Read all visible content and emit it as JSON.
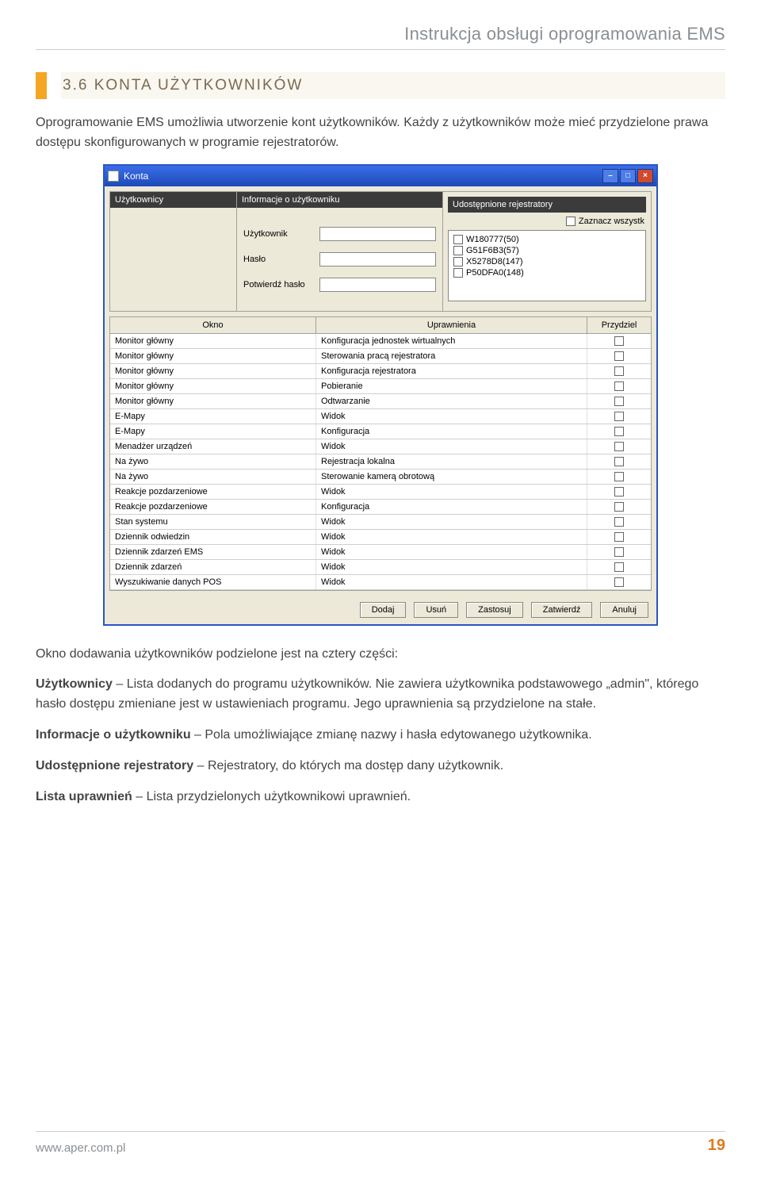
{
  "header": {
    "title": "Instrukcja obsługi oprogramowania EMS"
  },
  "section": {
    "number_title": "3.6   KONTA UŻYTKOWNIKÓW"
  },
  "intro_para": "Oprogramowanie EMS umożliwia utworzenie kont użytkowników. Każdy z użytkowników może mieć przydzielone prawa dostępu skonfigurowanych w programie rejestratorów.",
  "window": {
    "title": "Konta",
    "col_users_header": "Użytkownicy",
    "col_info_header": "Informacje o użytkowniku",
    "fields": {
      "user": "Użytkownik",
      "pass": "Hasło",
      "confirm": "Potwierdź hasło"
    },
    "col_regs_header": "Udostępnione rejestratory",
    "select_all": "Zaznacz wszystk",
    "regs": [
      "W180777(50)",
      "G51F6B3(57)",
      "X5278D8(147)",
      "P50DFA0(148)"
    ],
    "grid_headers": {
      "okno": "Okno",
      "upr": "Uprawnienia",
      "prz": "Przydziel"
    },
    "rows": [
      {
        "okno": "Monitor główny",
        "upr": "Konfiguracja jednostek wirtualnych"
      },
      {
        "okno": "Monitor główny",
        "upr": "Sterowania pracą rejestratora"
      },
      {
        "okno": "Monitor główny",
        "upr": "Konfiguracja rejestratora"
      },
      {
        "okno": "Monitor główny",
        "upr": "Pobieranie"
      },
      {
        "okno": "Monitor główny",
        "upr": "Odtwarzanie"
      },
      {
        "okno": "E-Mapy",
        "upr": "Widok"
      },
      {
        "okno": "E-Mapy",
        "upr": "Konfiguracja"
      },
      {
        "okno": "Menadżer urządzeń",
        "upr": "Widok"
      },
      {
        "okno": "Na żywo",
        "upr": "Rejestracja lokalna"
      },
      {
        "okno": "Na żywo",
        "upr": "Sterowanie kamerą obrotową"
      },
      {
        "okno": "Reakcje pozdarzeniowe",
        "upr": "Widok"
      },
      {
        "okno": "Reakcje pozdarzeniowe",
        "upr": "Konfiguracja"
      },
      {
        "okno": "Stan systemu",
        "upr": "Widok"
      },
      {
        "okno": "Dziennik odwiedzin",
        "upr": "Widok"
      },
      {
        "okno": "Dziennik zdarzeń EMS",
        "upr": "Widok"
      },
      {
        "okno": "Dziennik zdarzeń",
        "upr": "Widok"
      },
      {
        "okno": "Wyszukiwanie danych POS",
        "upr": "Widok"
      }
    ],
    "buttons": {
      "add": "Dodaj",
      "del": "Usuń",
      "apply": "Zastosuj",
      "confirm": "Zatwierdź",
      "cancel": "Anuluj"
    }
  },
  "below": {
    "p1": "Okno dodawania użytkowników podzielone jest na cztery części:",
    "p2a": "Użytkownicy",
    "p2b": " – Lista dodanych do programu użytkowników. Nie zawiera użytkownika podstawowego „admin\", którego hasło dostępu zmieniane jest w ustawieniach programu. Jego uprawnienia są przydzielone na stałe.",
    "p3a": "Informacje o użytkowniku",
    "p3b": " – Pola umożliwiające zmianę nazwy i hasła edytowanego użytkownika.",
    "p4a": "Udostępnione rejestratory",
    "p4b": " – Rejestratory, do których ma dostęp dany użytkownik.",
    "p5a": "Lista uprawnień",
    "p5b": " – Lista przydzielonych użytkownikowi uprawnień."
  },
  "footer": {
    "url": "www.aper.com.pl",
    "page": "19"
  }
}
